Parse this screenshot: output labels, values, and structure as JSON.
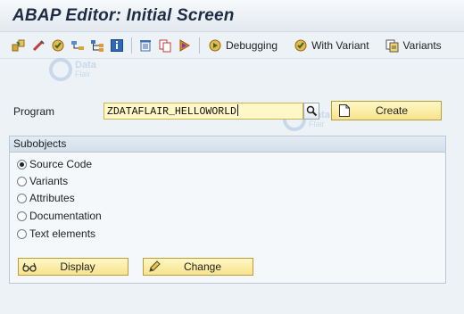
{
  "window": {
    "title": "ABAP Editor: Initial Screen"
  },
  "toolbar": {
    "icons": [
      "other-object-icon",
      "display-object-list-icon",
      "check-icon",
      "where-used-icon",
      "info-icon",
      "delete-icon",
      "copy-icon",
      "execute-icon"
    ],
    "debugging_label": "Debugging",
    "with_variant_label": "With Variant",
    "variants_label": "Variants"
  },
  "program": {
    "label": "Program",
    "value": "ZDATAFLAIR_HELLOWORLD",
    "create_label": "Create"
  },
  "subobjects": {
    "title": "Subobjects",
    "options": [
      {
        "label": "Source Code",
        "selected": true
      },
      {
        "label": "Variants",
        "selected": false
      },
      {
        "label": "Attributes",
        "selected": false
      },
      {
        "label": "Documentation",
        "selected": false
      },
      {
        "label": "Text elements",
        "selected": false
      }
    ],
    "display_label": "Display",
    "change_label": "Change"
  },
  "watermark": {
    "line1": "Data",
    "line2": "Flair"
  },
  "colors": {
    "background": "#edf2f7",
    "input_highlight": "#fff7c7",
    "button_fill": "#f7e38c",
    "title_text": "#1d2c44"
  }
}
